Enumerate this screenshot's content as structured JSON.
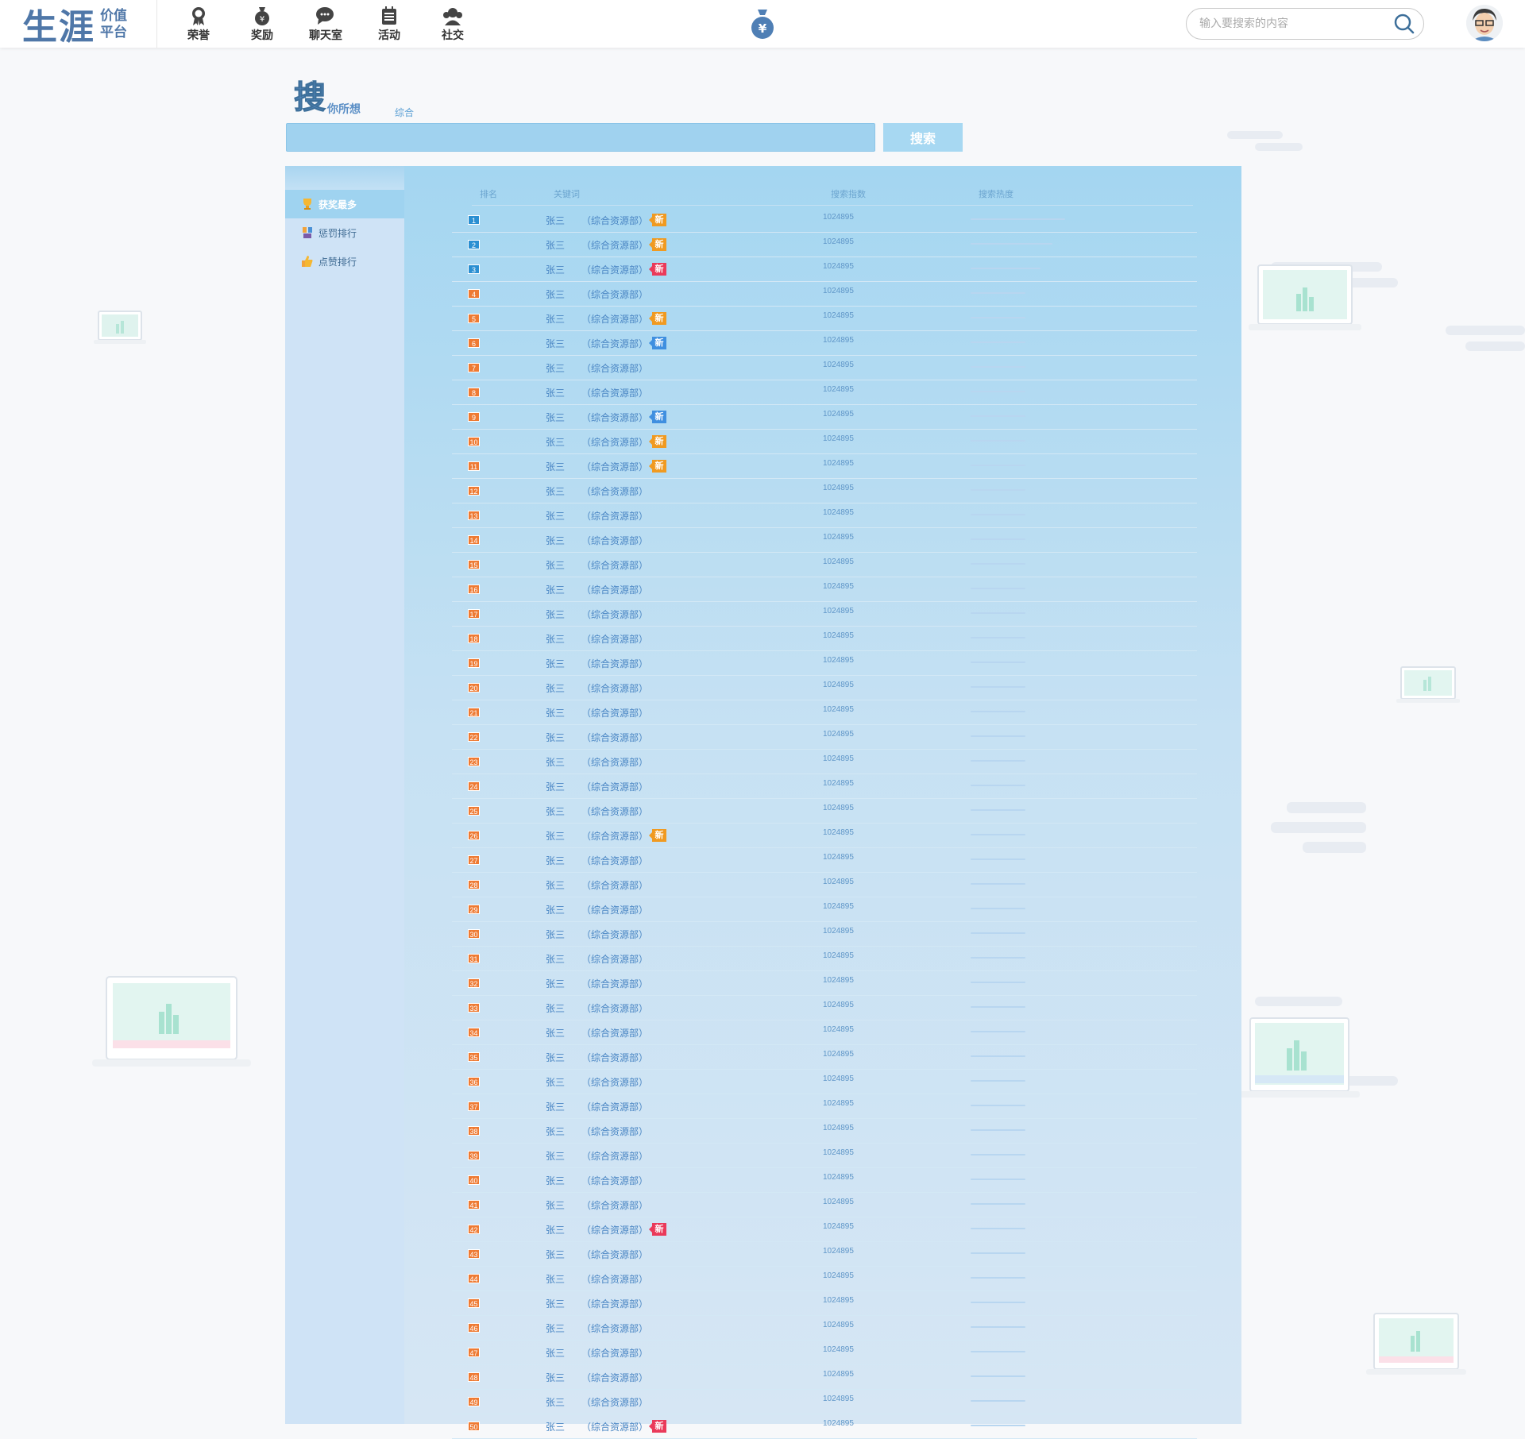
{
  "header": {
    "logo_main": "生涯",
    "logo_sub_1": "价值",
    "logo_sub_2": "平台",
    "nav": [
      {
        "label": "荣誉",
        "icon": "medal-icon"
      },
      {
        "label": "奖励",
        "icon": "money-bag-icon"
      },
      {
        "label": "聊天室",
        "icon": "chat-icon"
      },
      {
        "label": "活动",
        "icon": "calendar-icon"
      },
      {
        "label": "社交",
        "icon": "people-icon"
      }
    ],
    "search_placeholder": "输入要搜索的内容"
  },
  "search": {
    "brand_main": "搜",
    "brand_sub": "你所想",
    "scope": "综合",
    "button": "搜索"
  },
  "sidebar": {
    "items": [
      {
        "label": "获奖最多",
        "icon": "trophy-icon",
        "active": true
      },
      {
        "label": "惩罚排行",
        "icon": "punish-icon",
        "active": false
      },
      {
        "label": "点赞排行",
        "icon": "thumbs-up-icon",
        "active": false
      }
    ]
  },
  "table": {
    "headers": {
      "rank": "排名",
      "keyword": "关键词",
      "index": "搜索指数",
      "heat": "搜索热度"
    },
    "rows": [
      {
        "rank": "1",
        "name": "张三",
        "dept": "（综合资源部）",
        "badge": "新",
        "badge_color": "orange",
        "index": "1024895",
        "heat": 0.95
      },
      {
        "rank": "2",
        "name": "张三",
        "dept": "（综合资源部）",
        "badge": "新",
        "badge_color": "orange",
        "index": "1024895",
        "heat": 0.82
      },
      {
        "rank": "3",
        "name": "张三",
        "dept": "（综合资源部）",
        "badge": "新",
        "badge_color": "red",
        "index": "1024895",
        "heat": 0.7
      },
      {
        "rank": "4",
        "name": "张三",
        "dept": "（综合资源部）",
        "badge": "",
        "badge_color": "",
        "index": "1024895",
        "heat": 0.55
      },
      {
        "rank": "5",
        "name": "张三",
        "dept": "（综合资源部）",
        "badge": "新",
        "badge_color": "orange",
        "index": "1024895",
        "heat": 0.55
      },
      {
        "rank": "6",
        "name": "张三",
        "dept": "（综合资源部）",
        "badge": "新",
        "badge_color": "blue",
        "index": "1024895",
        "heat": 0.55
      },
      {
        "rank": "7",
        "name": "张三",
        "dept": "（综合资源部）",
        "badge": "",
        "badge_color": "",
        "index": "1024895",
        "heat": 0.55
      },
      {
        "rank": "8",
        "name": "张三",
        "dept": "（综合资源部）",
        "badge": "",
        "badge_color": "",
        "index": "1024895",
        "heat": 0.55
      },
      {
        "rank": "9",
        "name": "张三",
        "dept": "（综合资源部）",
        "badge": "新",
        "badge_color": "blue",
        "index": "1024895",
        "heat": 0.55
      },
      {
        "rank": "10",
        "name": "张三",
        "dept": "（综合资源部）",
        "badge": "新",
        "badge_color": "orange",
        "index": "1024895",
        "heat": 0.55
      },
      {
        "rank": "11",
        "name": "张三",
        "dept": "（综合资源部）",
        "badge": "新",
        "badge_color": "orange",
        "index": "1024895",
        "heat": 0.55
      },
      {
        "rank": "12",
        "name": "张三",
        "dept": "（综合资源部）",
        "badge": "",
        "badge_color": "",
        "index": "1024895",
        "heat": 0.55
      },
      {
        "rank": "13",
        "name": "张三",
        "dept": "（综合资源部）",
        "badge": "",
        "badge_color": "",
        "index": "1024895",
        "heat": 0.55
      },
      {
        "rank": "14",
        "name": "张三",
        "dept": "（综合资源部）",
        "badge": "",
        "badge_color": "",
        "index": "1024895",
        "heat": 0.55
      },
      {
        "rank": "15",
        "name": "张三",
        "dept": "（综合资源部）",
        "badge": "",
        "badge_color": "",
        "index": "1024895",
        "heat": 0.55
      },
      {
        "rank": "16",
        "name": "张三",
        "dept": "（综合资源部）",
        "badge": "",
        "badge_color": "",
        "index": "1024895",
        "heat": 0.55
      },
      {
        "rank": "17",
        "name": "张三",
        "dept": "（综合资源部）",
        "badge": "",
        "badge_color": "",
        "index": "1024895",
        "heat": 0.55
      },
      {
        "rank": "18",
        "name": "张三",
        "dept": "（综合资源部）",
        "badge": "",
        "badge_color": "",
        "index": "1024895",
        "heat": 0.55
      },
      {
        "rank": "19",
        "name": "张三",
        "dept": "（综合资源部）",
        "badge": "",
        "badge_color": "",
        "index": "1024895",
        "heat": 0.55
      },
      {
        "rank": "20",
        "name": "张三",
        "dept": "（综合资源部）",
        "badge": "",
        "badge_color": "",
        "index": "1024895",
        "heat": 0.55
      },
      {
        "rank": "21",
        "name": "张三",
        "dept": "（综合资源部）",
        "badge": "",
        "badge_color": "",
        "index": "1024895",
        "heat": 0.55
      },
      {
        "rank": "22",
        "name": "张三",
        "dept": "（综合资源部）",
        "badge": "",
        "badge_color": "",
        "index": "1024895",
        "heat": 0.55
      },
      {
        "rank": "23",
        "name": "张三",
        "dept": "（综合资源部）",
        "badge": "",
        "badge_color": "",
        "index": "1024895",
        "heat": 0.55
      },
      {
        "rank": "24",
        "name": "张三",
        "dept": "（综合资源部）",
        "badge": "",
        "badge_color": "",
        "index": "1024895",
        "heat": 0.55
      },
      {
        "rank": "25",
        "name": "张三",
        "dept": "（综合资源部）",
        "badge": "",
        "badge_color": "",
        "index": "1024895",
        "heat": 0.55
      },
      {
        "rank": "26",
        "name": "张三",
        "dept": "（综合资源部）",
        "badge": "新",
        "badge_color": "orange",
        "index": "1024895",
        "heat": 0.55
      },
      {
        "rank": "27",
        "name": "张三",
        "dept": "（综合资源部）",
        "badge": "",
        "badge_color": "",
        "index": "1024895",
        "heat": 0.55
      },
      {
        "rank": "28",
        "name": "张三",
        "dept": "（综合资源部）",
        "badge": "",
        "badge_color": "",
        "index": "1024895",
        "heat": 0.55
      },
      {
        "rank": "29",
        "name": "张三",
        "dept": "（综合资源部）",
        "badge": "",
        "badge_color": "",
        "index": "1024895",
        "heat": 0.55
      },
      {
        "rank": "30",
        "name": "张三",
        "dept": "（综合资源部）",
        "badge": "",
        "badge_color": "",
        "index": "1024895",
        "heat": 0.55
      },
      {
        "rank": "31",
        "name": "张三",
        "dept": "（综合资源部）",
        "badge": "",
        "badge_color": "",
        "index": "1024895",
        "heat": 0.55
      },
      {
        "rank": "32",
        "name": "张三",
        "dept": "（综合资源部）",
        "badge": "",
        "badge_color": "",
        "index": "1024895",
        "heat": 0.55
      },
      {
        "rank": "33",
        "name": "张三",
        "dept": "（综合资源部）",
        "badge": "",
        "badge_color": "",
        "index": "1024895",
        "heat": 0.55
      },
      {
        "rank": "34",
        "name": "张三",
        "dept": "（综合资源部）",
        "badge": "",
        "badge_color": "",
        "index": "1024895",
        "heat": 0.55
      },
      {
        "rank": "35",
        "name": "张三",
        "dept": "（综合资源部）",
        "badge": "",
        "badge_color": "",
        "index": "1024895",
        "heat": 0.55
      },
      {
        "rank": "36",
        "name": "张三",
        "dept": "（综合资源部）",
        "badge": "",
        "badge_color": "",
        "index": "1024895",
        "heat": 0.55
      },
      {
        "rank": "37",
        "name": "张三",
        "dept": "（综合资源部）",
        "badge": "",
        "badge_color": "",
        "index": "1024895",
        "heat": 0.55
      },
      {
        "rank": "38",
        "name": "张三",
        "dept": "（综合资源部）",
        "badge": "",
        "badge_color": "",
        "index": "1024895",
        "heat": 0.55
      },
      {
        "rank": "39",
        "name": "张三",
        "dept": "（综合资源部）",
        "badge": "",
        "badge_color": "",
        "index": "1024895",
        "heat": 0.55
      },
      {
        "rank": "40",
        "name": "张三",
        "dept": "（综合资源部）",
        "badge": "",
        "badge_color": "",
        "index": "1024895",
        "heat": 0.55
      },
      {
        "rank": "41",
        "name": "张三",
        "dept": "（综合资源部）",
        "badge": "",
        "badge_color": "",
        "index": "1024895",
        "heat": 0.55
      },
      {
        "rank": "42",
        "name": "张三",
        "dept": "（综合资源部）",
        "badge": "新",
        "badge_color": "red",
        "index": "1024895",
        "heat": 0.55
      },
      {
        "rank": "43",
        "name": "张三",
        "dept": "（综合资源部）",
        "badge": "",
        "badge_color": "",
        "index": "1024895",
        "heat": 0.55
      },
      {
        "rank": "44",
        "name": "张三",
        "dept": "（综合资源部）",
        "badge": "",
        "badge_color": "",
        "index": "1024895",
        "heat": 0.55
      },
      {
        "rank": "45",
        "name": "张三",
        "dept": "（综合资源部）",
        "badge": "",
        "badge_color": "",
        "index": "1024895",
        "heat": 0.55
      },
      {
        "rank": "46",
        "name": "张三",
        "dept": "（综合资源部）",
        "badge": "",
        "badge_color": "",
        "index": "1024895",
        "heat": 0.55
      },
      {
        "rank": "47",
        "name": "张三",
        "dept": "（综合资源部）",
        "badge": "",
        "badge_color": "",
        "index": "1024895",
        "heat": 0.55
      },
      {
        "rank": "48",
        "name": "张三",
        "dept": "（综合资源部）",
        "badge": "",
        "badge_color": "",
        "index": "1024895",
        "heat": 0.55
      },
      {
        "rank": "49",
        "name": "张三",
        "dept": "（综合资源部）",
        "badge": "",
        "badge_color": "",
        "index": "1024895",
        "heat": 0.55
      },
      {
        "rank": "50",
        "name": "张三",
        "dept": "（综合资源部）",
        "badge": "新",
        "badge_color": "red",
        "index": "1024895",
        "heat": 0.55
      }
    ]
  }
}
